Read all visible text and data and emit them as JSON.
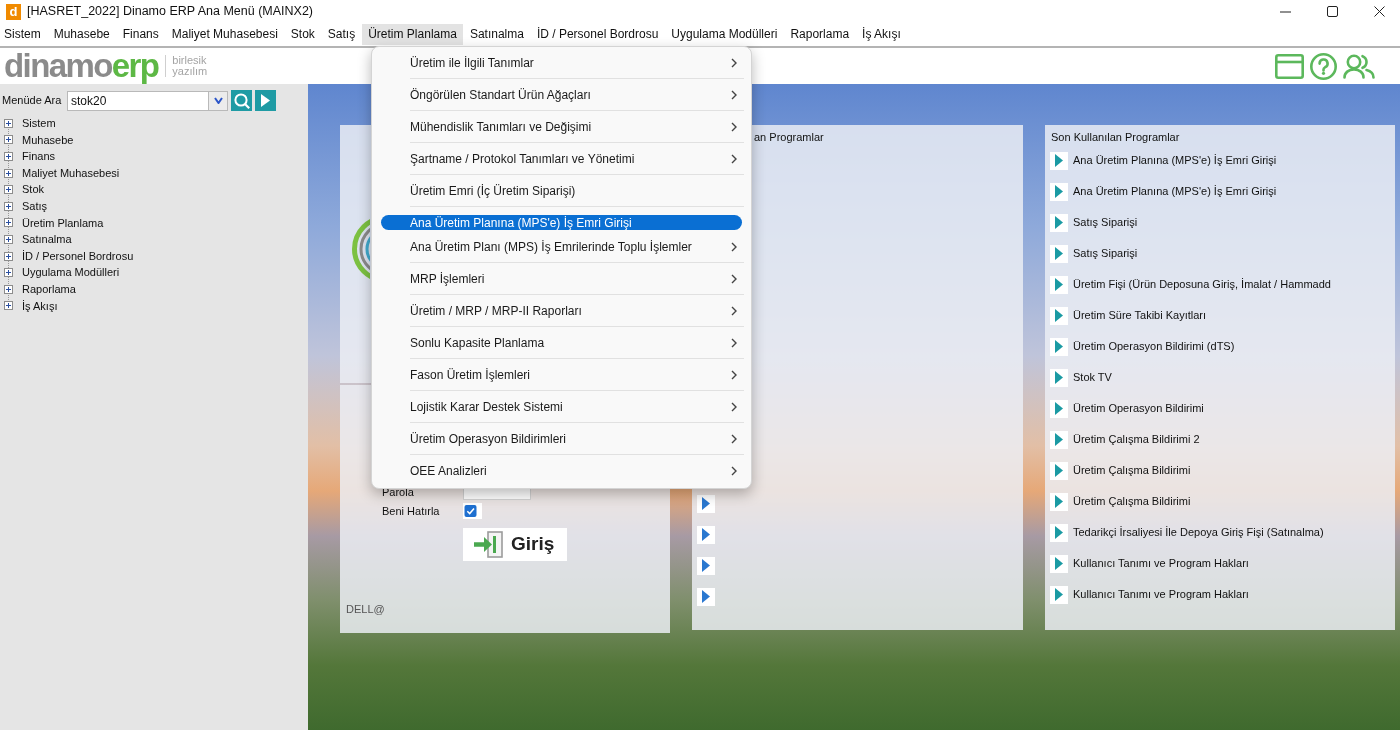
{
  "window": {
    "icon_letter": "d",
    "title": "[HASRET_2022] Dinamo ERP Ana Menü (MAINX2)"
  },
  "menu_bar": [
    {
      "label": "Sistem",
      "selected": false
    },
    {
      "label": "Muhasebe",
      "selected": false
    },
    {
      "label": "Finans",
      "selected": false
    },
    {
      "label": "Maliyet Muhasebesi",
      "selected": false
    },
    {
      "label": "Stok",
      "selected": false
    },
    {
      "label": "Satış",
      "selected": false
    },
    {
      "label": "Üretim Planlama",
      "selected": true
    },
    {
      "label": "Satınalma",
      "selected": false
    },
    {
      "label": "İD / Personel Bordrosu",
      "selected": false
    },
    {
      "label": "Uygulama Modülleri",
      "selected": false
    },
    {
      "label": "Raporlama",
      "selected": false
    },
    {
      "label": "İş Akışı",
      "selected": false
    }
  ],
  "dropdown_menu": {
    "items": [
      {
        "label": "Üretim ile İlgili Tanımlar",
        "has_submenu": true,
        "selected": false
      },
      {
        "label": "Öngörülen Standart Ürün Ağaçları",
        "has_submenu": true,
        "selected": false
      },
      {
        "label": "Mühendislik Tanımları ve Değişimi",
        "has_submenu": true,
        "selected": false
      },
      {
        "label": "Şartname / Protokol Tanımları ve Yönetimi",
        "has_submenu": true,
        "selected": false
      },
      {
        "label": "Üretim Emri (İç Üretim Siparişi)",
        "has_submenu": false,
        "selected": false
      },
      {
        "label": "Ana Üretim Planına (MPS'e) İş Emri Girişi",
        "has_submenu": false,
        "selected": true
      },
      {
        "label": "Ana Üretim Planı (MPS) İş Emrilerinde Toplu İşlemler",
        "has_submenu": true,
        "selected": false
      },
      {
        "label": "MRP İşlemleri",
        "has_submenu": true,
        "selected": false
      },
      {
        "label": "Üretim / MRP / MRP-II Raporları",
        "has_submenu": true,
        "selected": false
      },
      {
        "label": "Sonlu Kapasite Planlama",
        "has_submenu": true,
        "selected": false
      },
      {
        "label": "Fason Üretim İşlemleri",
        "has_submenu": true,
        "selected": false
      },
      {
        "label": "Lojistik Karar Destek Sistemi",
        "has_submenu": true,
        "selected": false
      },
      {
        "label": "Üretim Operasyon Bildirimleri",
        "has_submenu": true,
        "selected": false
      },
      {
        "label": "OEE Analizleri",
        "has_submenu": true,
        "selected": false
      }
    ]
  },
  "logo": {
    "name_part_1": "dinamo",
    "name_part_2": "erp",
    "tagline": [
      "birlesik",
      "yazılım"
    ]
  },
  "sidebar": {
    "search_label": "Menüde Ara",
    "search_value": "stok20",
    "tree": [
      {
        "label": "Sistem",
        "expanded": false
      },
      {
        "label": "Muhasebe",
        "expanded": false
      },
      {
        "label": "Finans",
        "expanded": false
      },
      {
        "label": "Maliyet Muhasebesi",
        "expanded": false
      },
      {
        "label": "Stok",
        "expanded": false
      },
      {
        "label": "Satış",
        "expanded": false
      },
      {
        "label": "Üretim Planlama",
        "expanded": false
      },
      {
        "label": "Satınalma",
        "expanded": false
      },
      {
        "label": "İD / Personel Bordrosu",
        "expanded": false
      },
      {
        "label": "Uygulama Modülleri",
        "expanded": false
      },
      {
        "label": "Raporlama",
        "expanded": false
      },
      {
        "label": "İş Akışı",
        "expanded": false
      }
    ]
  },
  "login_panel": {
    "password_label": "Parola",
    "remember_label": "Beni Hatırla",
    "remember_checked": true,
    "login_button": "Giriş",
    "footer": "DELL@"
  },
  "programs_panel": {
    "title": "an Programlar",
    "items": [
      {
        "kind": "launch"
      },
      {
        "kind": "launch"
      },
      {
        "kind": "launch"
      },
      {
        "kind": "launch"
      }
    ]
  },
  "recent_panel": {
    "title": "Son Kullanılan Programlar",
    "items": [
      "Ana Üretim Planına (MPS'e) İş Emri Girişi",
      "Ana Üretim Planına (MPS'e) İş Emri Girişi",
      "Satış Siparişi",
      "Satış Siparişi",
      "Üretim Fişi (Ürün Deposuna Giriş, İmalat / Hammadd",
      "Üretim Süre Takibi Kayıtları",
      "Üretim Operasyon Bildirimi (dTS)",
      "Stok TV",
      "Üretim Operasyon Bildirimi",
      "Üretim Çalışma Bildirimi 2",
      "Üretim Çalışma Bildirimi",
      "Üretim Çalışma Bildirimi",
      "Tedarikçi İrsaliyesi İle Depoya Giriş Fişi (Satınalma)",
      "Kullanıcı Tanımı ve Program Hakları",
      "Kullanıcı Tanımı ve Program Hakları"
    ]
  }
}
